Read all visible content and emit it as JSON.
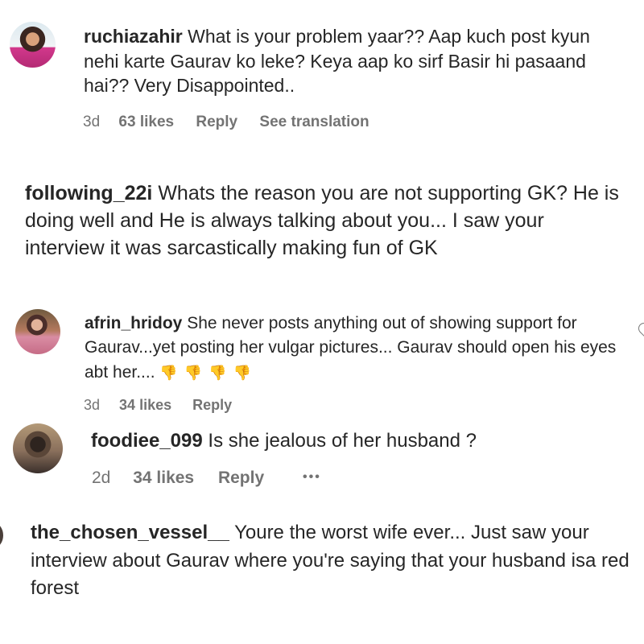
{
  "comments": [
    {
      "username": "ruchiazahir",
      "text": "What is your problem yaar?? Aap kuch post kyun nehi karte Gaurav ko leke? Keya aap ko sirf Basir hi pasaand hai?? Very Disappointed..",
      "time": "3d",
      "likes": "63 likes",
      "reply": "Reply",
      "translate": "See translation"
    },
    {
      "username": "following_22i",
      "text": "Whats the reason you are not supporting GK? He is doing well and He is always talking about you... I saw your interview it was sarcastically making fun of GK"
    },
    {
      "username": "afrin_hridoy",
      "text": "She never posts anything out of showing support for Gaurav...yet posting her vulgar pictures... Gaurav should open his eyes abt her....",
      "emoji": "👎👎👎👎",
      "time": "3d",
      "likes": "34 likes",
      "reply": "Reply"
    },
    {
      "username": "foodiee_099",
      "text": "Is she jealous of her husband ?",
      "time": "2d",
      "likes": "34 likes",
      "reply": "Reply",
      "more": "•••"
    },
    {
      "username": "the_chosen_vessel__",
      "text": "Youre the worst wife ever... Just saw your interview about Gaurav where you're saying that your husband isa red forest"
    }
  ],
  "colors": {
    "text": "#262626",
    "meta": "#737373",
    "emoji": "#f5a623"
  },
  "icons": [
    "heart-icon",
    "more-options-icon"
  ]
}
